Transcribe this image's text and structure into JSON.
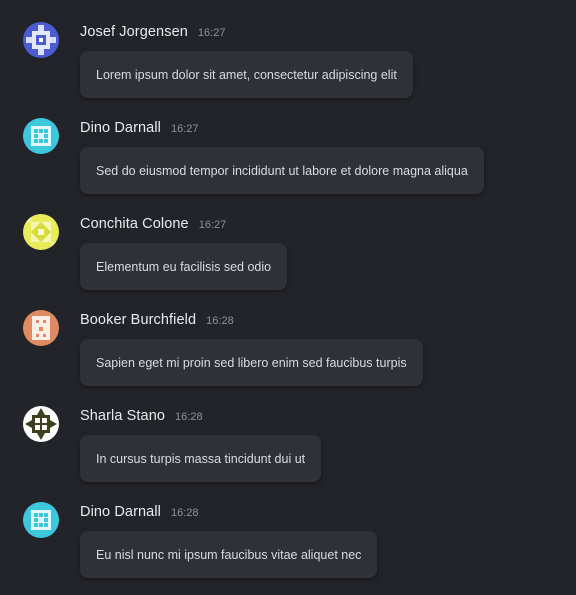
{
  "messages": [
    {
      "author": "Josef Jorgensen",
      "time": "16:27",
      "text": "Lorem ipsum dolor sit amet, consectetur adipiscing elit",
      "avatar": "blue-pattern-avatar"
    },
    {
      "author": "Dino Darnall",
      "time": "16:27",
      "text": "Sed do eiusmod tempor incididunt ut labore et dolore magna aliqua",
      "avatar": "cyan-pattern-avatar"
    },
    {
      "author": "Conchita Colone",
      "time": "16:27",
      "text": "Elementum eu facilisis sed odio",
      "avatar": "yellow-pattern-avatar"
    },
    {
      "author": "Booker Burchfield",
      "time": "16:28",
      "text": "Sapien eget mi proin sed libero enim sed faucibus turpis",
      "avatar": "orange-pattern-avatar"
    },
    {
      "author": "Sharla Stano",
      "time": "16:28",
      "text": "In cursus turpis massa tincidunt dui ut",
      "avatar": "olive-pattern-avatar"
    },
    {
      "author": "Dino Darnall",
      "time": "16:28",
      "text": "Eu nisl nunc mi ipsum faucibus vitae aliquet nec",
      "avatar": "cyan-pattern-avatar"
    }
  ],
  "colors": {
    "background": "#232429",
    "bubble": "#2f3139",
    "avatar_blue": "#4a5bd3",
    "avatar_cyan": "#3cc8dc",
    "avatar_yellow": "#e8ec5a",
    "avatar_orange": "#e08a62",
    "avatar_olive": "#3d3f1f"
  }
}
